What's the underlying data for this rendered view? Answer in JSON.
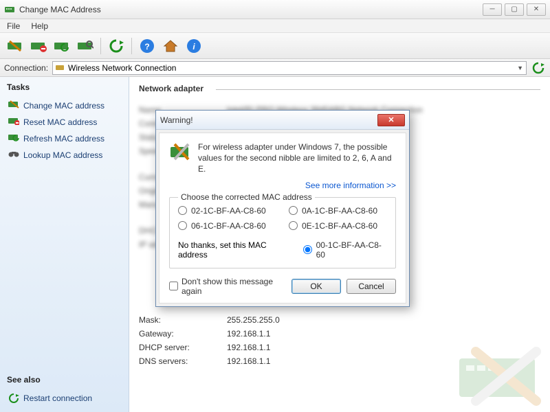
{
  "window": {
    "title": "Change MAC Address"
  },
  "menu": {
    "file": "File",
    "help": "Help"
  },
  "connbar": {
    "label": "Connection:",
    "value": "Wireless Network Connection"
  },
  "sidebar": {
    "tasks_header": "Tasks",
    "tasks": [
      {
        "label": "Change MAC address"
      },
      {
        "label": "Reset MAC address"
      },
      {
        "label": "Refresh MAC address"
      },
      {
        "label": "Lookup MAC address"
      }
    ],
    "seealso_header": "See also",
    "seealso": [
      {
        "label": "Restart connection"
      }
    ]
  },
  "content": {
    "group_header": "Network adapter",
    "fields": {
      "mask": {
        "label": "Mask:",
        "value": "255.255.255.0"
      },
      "gateway": {
        "label": "Gateway:",
        "value": "192.168.1.1"
      },
      "dhcp": {
        "label": "DHCP server:",
        "value": "192.168.1.1"
      },
      "dns": {
        "label": "DNS servers:",
        "value": "192.168.1.1"
      }
    }
  },
  "dialog": {
    "title": "Warning!",
    "message": "For wireless adapter under Windows 7, the possible values for the second nibble are limited to 2, 6, A and E.",
    "link": "See more information >>",
    "fieldset_legend": "Choose the corrected MAC address",
    "options": [
      "02-1C-BF-AA-C8-60",
      "0A-1C-BF-AA-C8-60",
      "06-1C-BF-AA-C8-60",
      "0E-1C-BF-AA-C8-60"
    ],
    "no_thanks_label": "No thanks, set this MAC address",
    "no_thanks_value": "00-1C-BF-AA-C8-60",
    "dont_show": "Don't show this message again",
    "ok": "OK",
    "cancel": "Cancel"
  }
}
